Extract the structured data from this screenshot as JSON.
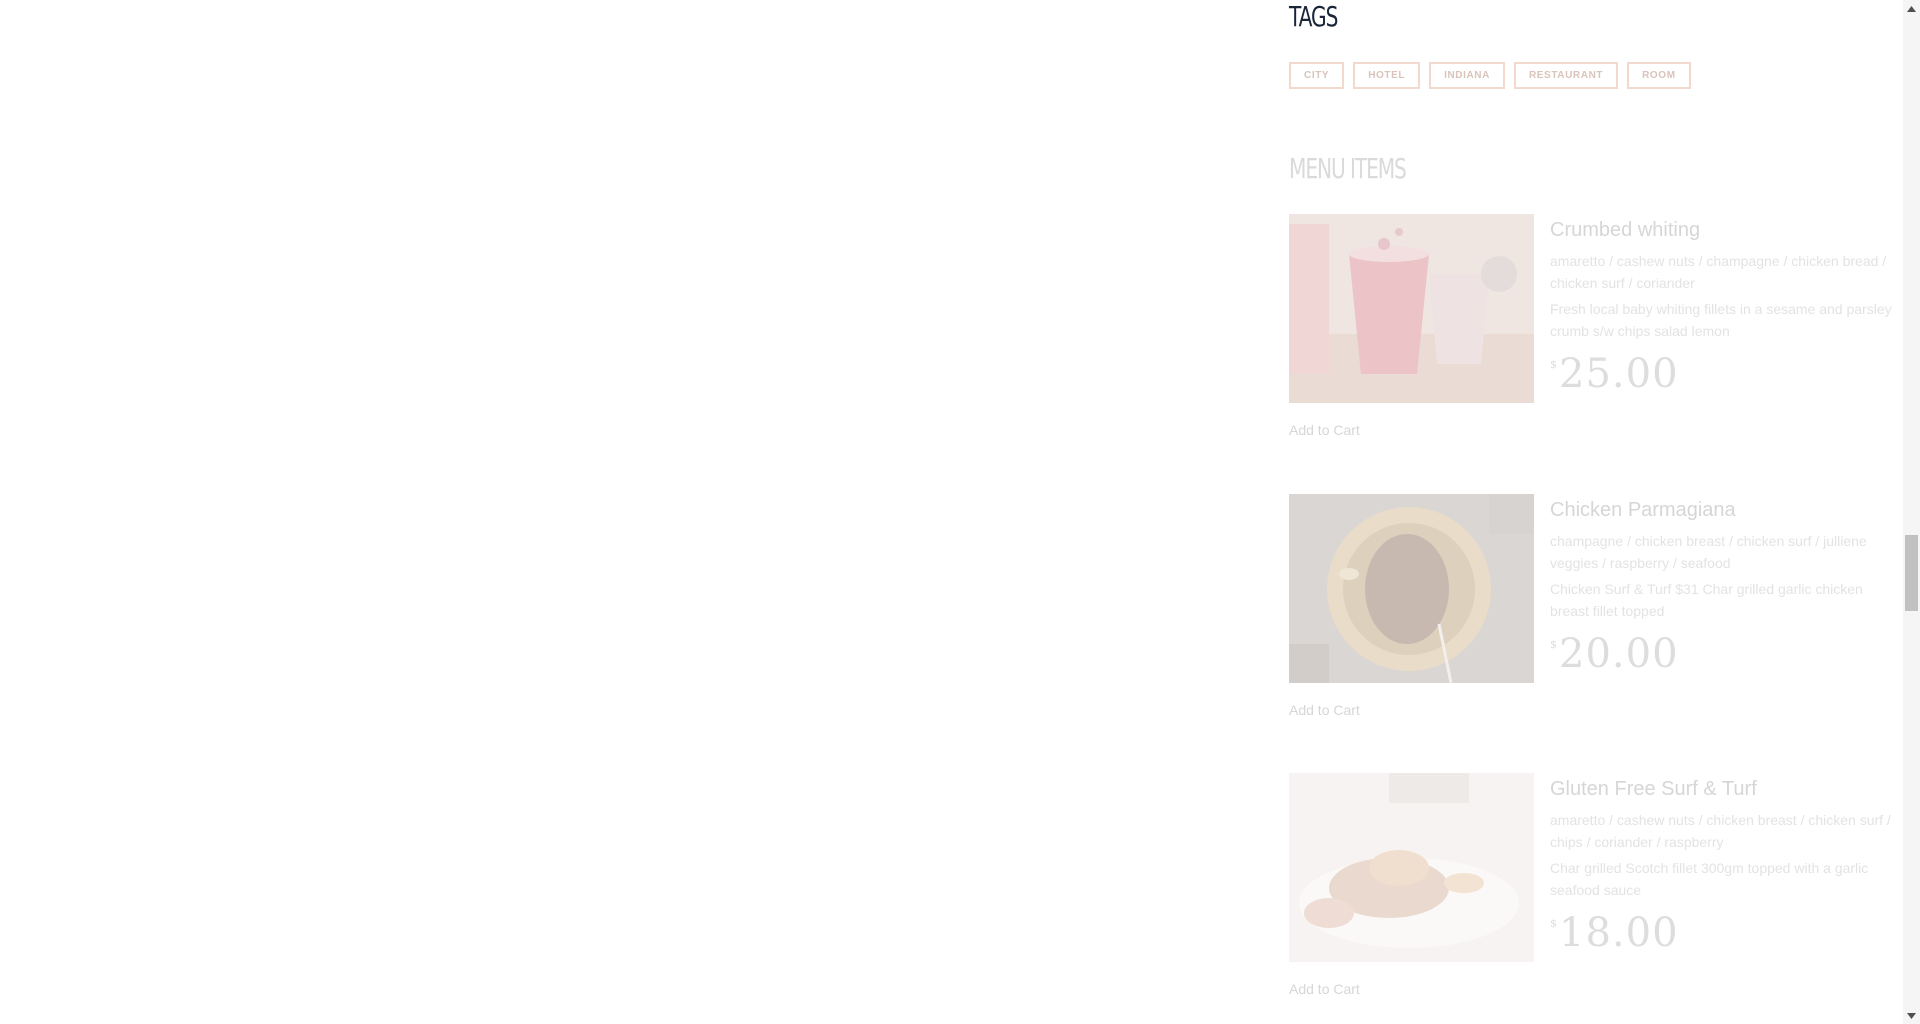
{
  "tags_section": {
    "title": "TAGS",
    "tags": [
      "CITY",
      "HOTEL",
      "INDIANA",
      "RESTAURANT",
      "ROOM"
    ]
  },
  "menu_section": {
    "title": "MENU ITEMS",
    "items": [
      {
        "name": "Crumbed whiting",
        "ingredients": "amaretto / cashew nuts / champagne / chicken bread / chicken surf / coriander",
        "description": "Fresh local baby whiting fillets in a sesame and parsley crumb s/w chips salad lemon",
        "currency": "$",
        "price": "25.00",
        "cart_label": "Add to Cart",
        "image": "drink-photo"
      },
      {
        "name": "Chicken Parmagiana",
        "ingredients": "champagne / chicken breast / chicken surf / julliene veggies / raspberry / seafood",
        "description": "Chicken Surf & Turf $31 Char grilled garlic chicken breast fillet topped",
        "currency": "$",
        "price": "20.00",
        "cart_label": "Add to Cart",
        "image": "steak-plate-photo"
      },
      {
        "name": "Gluten Free Surf & Turf",
        "ingredients": "amaretto / cashew nuts / chicken breast / chicken surf / chips / coriander / raspberry",
        "description": "Char grilled Scotch fillet 300gm topped with a garlic seafood sauce",
        "currency": "$",
        "price": "18.00",
        "cart_label": "Add to Cart",
        "image": "surf-turf-photo"
      }
    ]
  },
  "colors": {
    "tag_border": "#f1d9cd",
    "tags_title": "#1a2538",
    "faded_text": "#d6d6d6"
  },
  "icons": {
    "scroll_up": "arrow-up-icon",
    "scroll_down": "arrow-down-icon"
  }
}
